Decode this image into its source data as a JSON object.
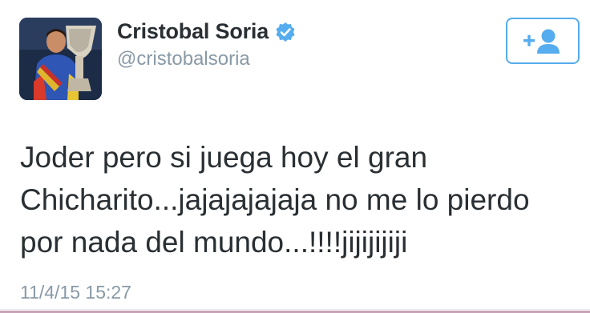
{
  "author": {
    "display_name": "Cristobal Soria",
    "handle": "@cristobalsoria",
    "verified": true,
    "avatar_icon": "profile-photo-trophy"
  },
  "follow_button": {
    "icon": "follow-user-icon",
    "color": "#55acee"
  },
  "tweet": {
    "text": "Joder pero si juega hoy el gran\nChicharito...jajajajajaja no me lo pierdo\npor nada del mundo...!!!!jijijijiji",
    "timestamp": "11/4/15 15:27"
  },
  "colors": {
    "accent": "#55acee",
    "text": "#292f33",
    "muted": "#8899a6"
  }
}
